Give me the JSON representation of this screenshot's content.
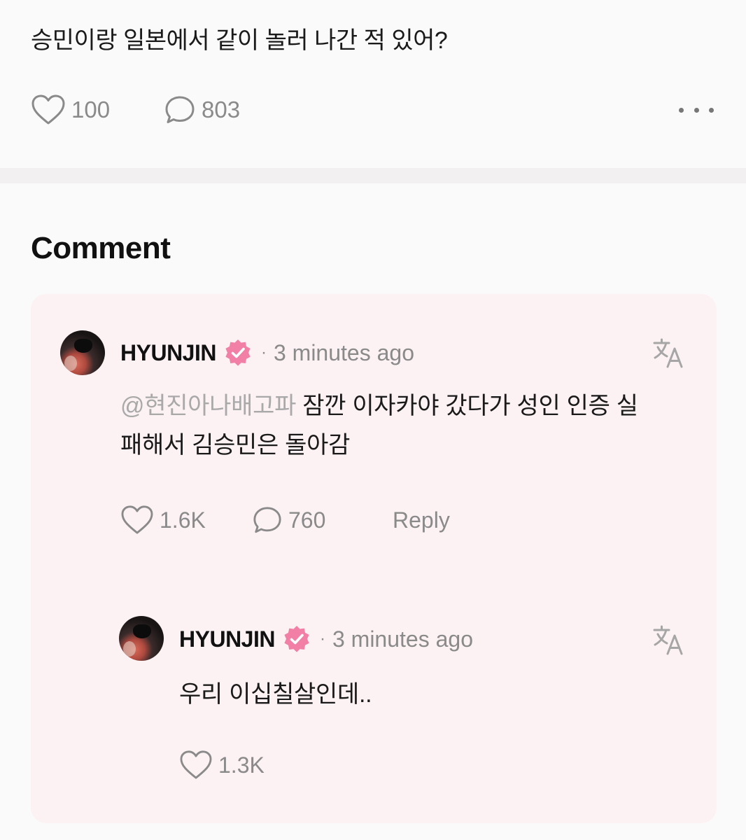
{
  "post": {
    "text": "승민이랑 일본에서 같이 놀러 나간 적 있어?",
    "likes": "100",
    "comments": "803"
  },
  "section_title": "Comment",
  "comment": {
    "username": "HYUNJIN",
    "dot": "·",
    "time": "3 minutes ago",
    "mention": "@현진아나배고파",
    "text_line1": " 잠깐 이자카야 갔다가 성인 인증 실",
    "text_line2": "패해서 김승민은 돌아감",
    "likes": "1.6K",
    "comments": "760",
    "reply_label": "Reply"
  },
  "reply": {
    "username": "HYUNJIN",
    "dot": "·",
    "time": "3 minutes ago",
    "text": "우리 이십칠살인데..",
    "likes": "1.3K"
  },
  "colors": {
    "verified_badge": "#f27fa6",
    "card_background": "#fcf2f3",
    "muted_text": "#8a8a8a"
  }
}
